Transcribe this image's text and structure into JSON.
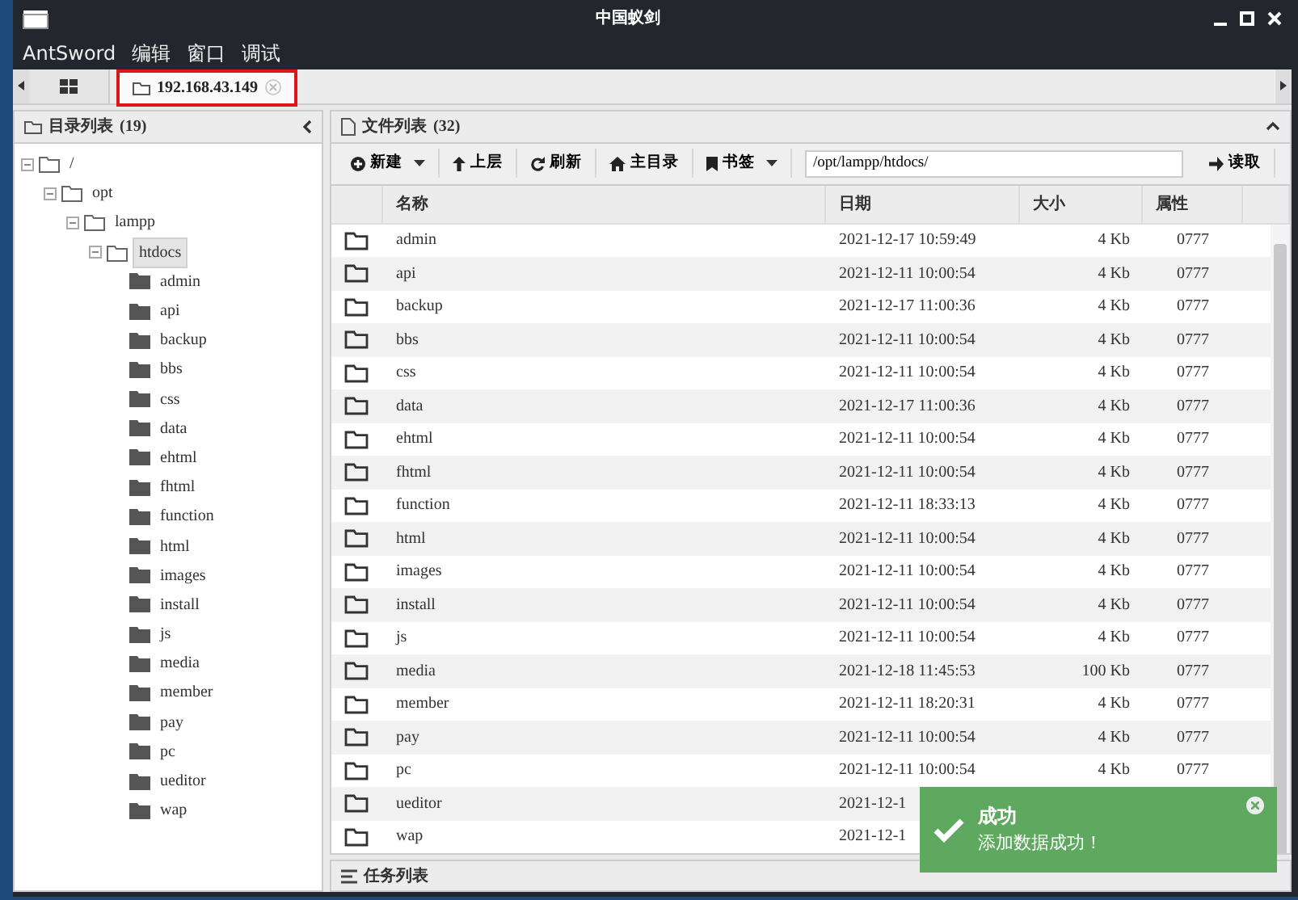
{
  "window": {
    "title": "中国蚁剑"
  },
  "menu": [
    "AntSword",
    "编辑",
    "窗口",
    "调试"
  ],
  "tabs": [
    {
      "label": "192.168.43.149",
      "selected": true,
      "highlighted": true
    }
  ],
  "directory_panel": {
    "title": "目录列表",
    "count": "(19)",
    "tree": [
      {
        "label": "/",
        "expanded": true,
        "selected": false,
        "children": [
          {
            "label": "opt",
            "expanded": true,
            "selected": false,
            "children": [
              {
                "label": "lampp",
                "expanded": true,
                "selected": false,
                "children": [
                  {
                    "label": "htdocs",
                    "expanded": true,
                    "selected": true,
                    "children": [
                      {
                        "label": "admin"
                      },
                      {
                        "label": "api"
                      },
                      {
                        "label": "backup"
                      },
                      {
                        "label": "bbs"
                      },
                      {
                        "label": "css"
                      },
                      {
                        "label": "data"
                      },
                      {
                        "label": "ehtml"
                      },
                      {
                        "label": "fhtml"
                      },
                      {
                        "label": "function"
                      },
                      {
                        "label": "html"
                      },
                      {
                        "label": "images"
                      },
                      {
                        "label": "install"
                      },
                      {
                        "label": "js"
                      },
                      {
                        "label": "media"
                      },
                      {
                        "label": "member"
                      },
                      {
                        "label": "pay"
                      },
                      {
                        "label": "pc"
                      },
                      {
                        "label": "ueditor"
                      },
                      {
                        "label": "wap"
                      }
                    ]
                  }
                ]
              }
            ]
          }
        ]
      }
    ]
  },
  "file_panel": {
    "title": "文件列表",
    "count": "(32)",
    "toolbar": [
      {
        "label": "新建",
        "kind": "new",
        "dropdown": true
      },
      {
        "label": "上层",
        "kind": "up",
        "dropdown": false
      },
      {
        "label": "刷新",
        "kind": "refresh",
        "dropdown": false
      },
      {
        "label": "主目录",
        "kind": "home",
        "dropdown": false
      },
      {
        "label": "书签",
        "kind": "bookmark",
        "dropdown": true
      }
    ],
    "path": "/opt/lampp/htdocs/",
    "read_button": "读取",
    "columns": [
      "名称",
      "日期",
      "大小",
      "属性"
    ],
    "rows": [
      [
        "admin",
        "2021-12-17 10:59:49",
        "4 Kb",
        "0777"
      ],
      [
        "api",
        "2021-12-11 10:00:54",
        "4 Kb",
        "0777"
      ],
      [
        "backup",
        "2021-12-17 11:00:36",
        "4 Kb",
        "0777"
      ],
      [
        "bbs",
        "2021-12-11 10:00:54",
        "4 Kb",
        "0777"
      ],
      [
        "css",
        "2021-12-11 10:00:54",
        "4 Kb",
        "0777"
      ],
      [
        "data",
        "2021-12-17 11:00:36",
        "4 Kb",
        "0777"
      ],
      [
        "ehtml",
        "2021-12-11 10:00:54",
        "4 Kb",
        "0777"
      ],
      [
        "fhtml",
        "2021-12-11 10:00:54",
        "4 Kb",
        "0777"
      ],
      [
        "function",
        "2021-12-11 18:33:13",
        "4 Kb",
        "0777"
      ],
      [
        "html",
        "2021-12-11 10:00:54",
        "4 Kb",
        "0777"
      ],
      [
        "images",
        "2021-12-11 10:00:54",
        "4 Kb",
        "0777"
      ],
      [
        "install",
        "2021-12-11 10:00:54",
        "4 Kb",
        "0777"
      ],
      [
        "js",
        "2021-12-11 10:00:54",
        "4 Kb",
        "0777"
      ],
      [
        "media",
        "2021-12-18 11:45:53",
        "100 Kb",
        "0777"
      ],
      [
        "member",
        "2021-12-11 18:20:31",
        "4 Kb",
        "0777"
      ],
      [
        "pay",
        "2021-12-11 10:00:54",
        "4 Kb",
        "0777"
      ],
      [
        "pc",
        "2021-12-11 10:00:54",
        "4 Kb",
        "0777"
      ],
      [
        "ueditor",
        "2021-12-1"
      ],
      [
        "wap",
        "2021-12-1"
      ]
    ]
  },
  "task_panel": {
    "title": "任务列表"
  },
  "toast": {
    "title": "成功",
    "message": "添加数据成功！"
  }
}
